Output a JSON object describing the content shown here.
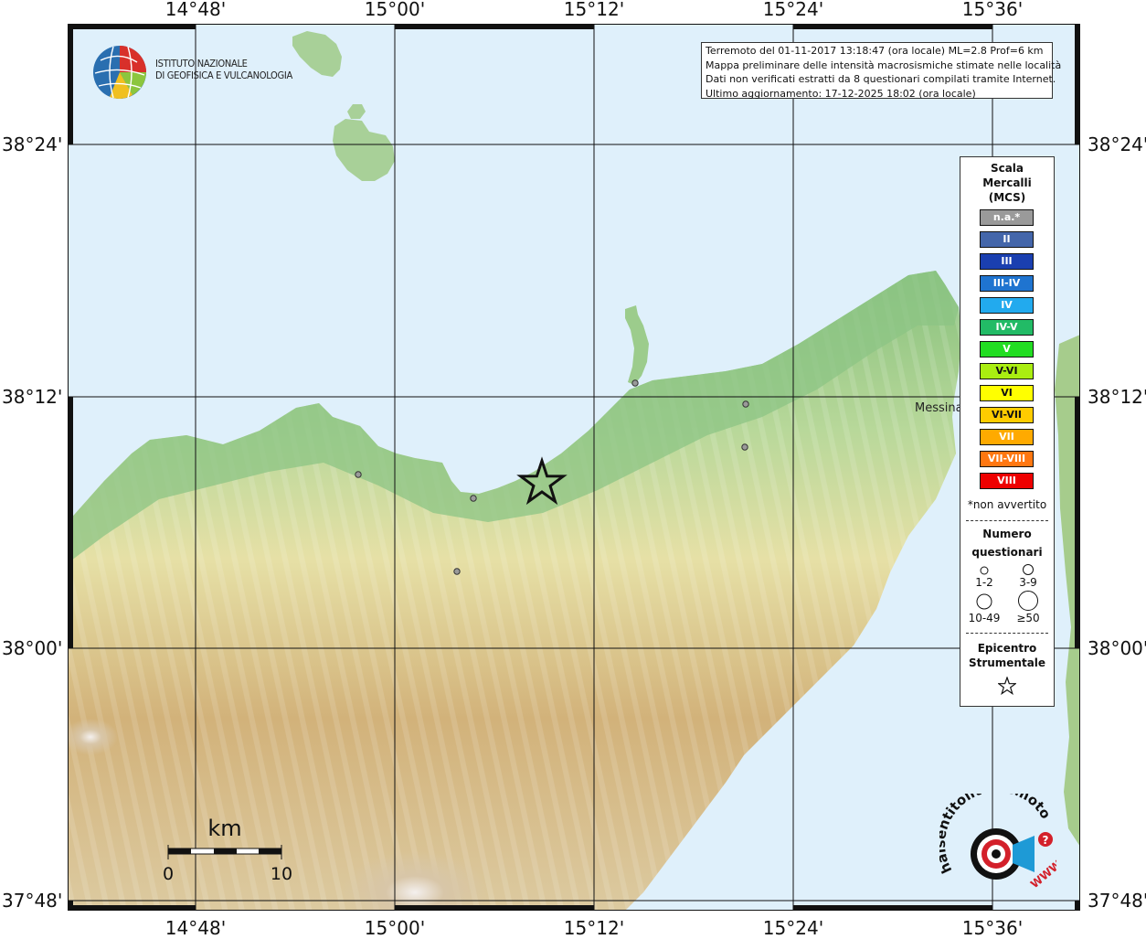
{
  "map": {
    "top_lon_labels": [
      "14°48'",
      "15°00'",
      "15°12'",
      "15°24'",
      "15°36'"
    ],
    "bottom_lon_labels": [
      "14°48'",
      "15°00'",
      "15°12'",
      "15°24'",
      "15°36'"
    ],
    "left_lat_labels": [
      "38°24'",
      "38°12'",
      "38°00'",
      "37°48'"
    ],
    "right_lat_labels": [
      "38°24'",
      "38°12'",
      "38°00'",
      "37°48'"
    ],
    "place_label": "Messina",
    "colors": {
      "sea": "#dff0fb",
      "lowland": "#8cc484",
      "hill": "#e8e2a8",
      "mountain": "#c8a870"
    }
  },
  "info": {
    "line1": "Terremoto del 01-11-2017 13:18:47 (ora locale) ML=2.8 Prof=6 km",
    "line2": "Mappa preliminare delle intensità macrosismiche stimate nelle località",
    "line3": "Dati non verificati estratti da 8 questionari compilati tramite Internet.",
    "line4": "Ultimo aggiornamento: 17-12-2025 18:02 (ora locale)"
  },
  "logo": {
    "line1": "ISTITUTO NAZIONALE",
    "line2": "DI GEOFISICA E VULCANOLOGIA"
  },
  "legend": {
    "title1": "Scala",
    "title2": "Mercalli",
    "title3": "(MCS)",
    "items": [
      {
        "label": "n.a.*",
        "color": "#9a9a9a"
      },
      {
        "label": "II",
        "color": "#4466aa"
      },
      {
        "label": "III",
        "color": "#1a3fb0"
      },
      {
        "label": "III-IV",
        "color": "#1f74d0"
      },
      {
        "label": "IV",
        "color": "#22aaee"
      },
      {
        "label": "IV-V",
        "color": "#22bb66"
      },
      {
        "label": "V",
        "color": "#22dd22"
      },
      {
        "label": "V-VI",
        "color": "#aaee11"
      },
      {
        "label": "VI",
        "color": "#ffff00"
      },
      {
        "label": "VI-VII",
        "color": "#ffcc00"
      },
      {
        "label": "VII",
        "color": "#ffaa00"
      },
      {
        "label": "VII-VIII",
        "color": "#ff7711"
      },
      {
        "label": "VIII",
        "color": "#ee0000"
      }
    ],
    "note": "*non avvertito",
    "count_title1": "Numero",
    "count_title2": "questionari",
    "count_labels": [
      "1-2",
      "3-9",
      "10-49",
      "≥50"
    ],
    "epicenter_title1": "Epicentro",
    "epicenter_title2": "Strumentale"
  },
  "scale_bar": {
    "unit": "km",
    "min": "0",
    "max": "10"
  },
  "brand": {
    "text": "haisentitoilterremoto.it",
    "sub": "WWW."
  }
}
